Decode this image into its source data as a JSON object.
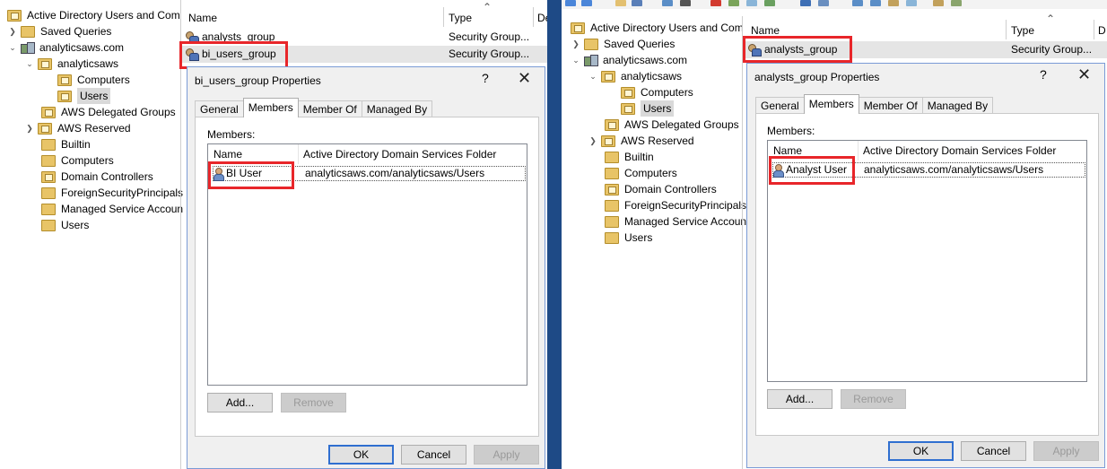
{
  "left": {
    "tree": {
      "root": "Active Directory Users and Com",
      "saved_queries": "Saved Queries",
      "domain": "analyticsaws.com",
      "ou": "analyticsaws",
      "computers_sub": "Computers",
      "users_sub": "Users",
      "aws_delegated": "AWS Delegated Groups",
      "aws_reserved": "AWS Reserved",
      "builtin": "Builtin",
      "computers": "Computers",
      "domain_controllers": "Domain Controllers",
      "foreign": "ForeignSecurityPrincipals",
      "managed": "Managed Service Accoun",
      "users": "Users"
    },
    "list": {
      "col_name": "Name",
      "col_type": "Type",
      "col_desc": "De",
      "rows": [
        {
          "name": "analysts_group",
          "type": "Security Group..."
        },
        {
          "name": "bi_users_group",
          "type": "Security Group..."
        }
      ]
    },
    "dialog": {
      "title": "bi_users_group Properties",
      "help": "?",
      "close": "✕",
      "tabs": [
        "General",
        "Members",
        "Member Of",
        "Managed By"
      ],
      "members_label": "Members:",
      "col_name": "Name",
      "col_folder": "Active Directory Domain Services Folder",
      "member": {
        "name": "BI User",
        "folder": "analyticsaws.com/analyticsaws/Users"
      },
      "add": "Add...",
      "remove": "Remove",
      "ok": "OK",
      "cancel": "Cancel",
      "apply": "Apply"
    }
  },
  "right": {
    "tree": {
      "root": "Active Directory Users and Com",
      "saved_queries": "Saved Queries",
      "domain": "analyticsaws.com",
      "ou": "analyticsaws",
      "computers_sub": "Computers",
      "users_sub": "Users",
      "aws_delegated": "AWS Delegated Groups",
      "aws_reserved": "AWS Reserved",
      "builtin": "Builtin",
      "computers": "Computers",
      "domain_controllers": "Domain Controllers",
      "foreign": "ForeignSecurityPrincipals",
      "managed": "Managed Service Accoun",
      "users": "Users"
    },
    "list": {
      "col_name": "Name",
      "col_type": "Type",
      "col_desc": "D",
      "rows": [
        {
          "name": "analysts_group",
          "type": "Security Group..."
        }
      ]
    },
    "dialog": {
      "title": "analysts_group Properties",
      "help": "?",
      "close": "✕",
      "tabs": [
        "General",
        "Members",
        "Member Of",
        "Managed By"
      ],
      "members_label": "Members:",
      "col_name": "Name",
      "col_folder": "Active Directory Domain Services Folder",
      "member": {
        "name": "Analyst User",
        "folder": "analyticsaws.com/analyticsaws/Users"
      },
      "add": "Add...",
      "remove": "Remove",
      "ok": "OK",
      "cancel": "Cancel",
      "apply": "Apply"
    }
  },
  "colors": {
    "highlight": "#e8262a",
    "accent": "#2f6fd0",
    "desktop": "#1e3f6d"
  }
}
